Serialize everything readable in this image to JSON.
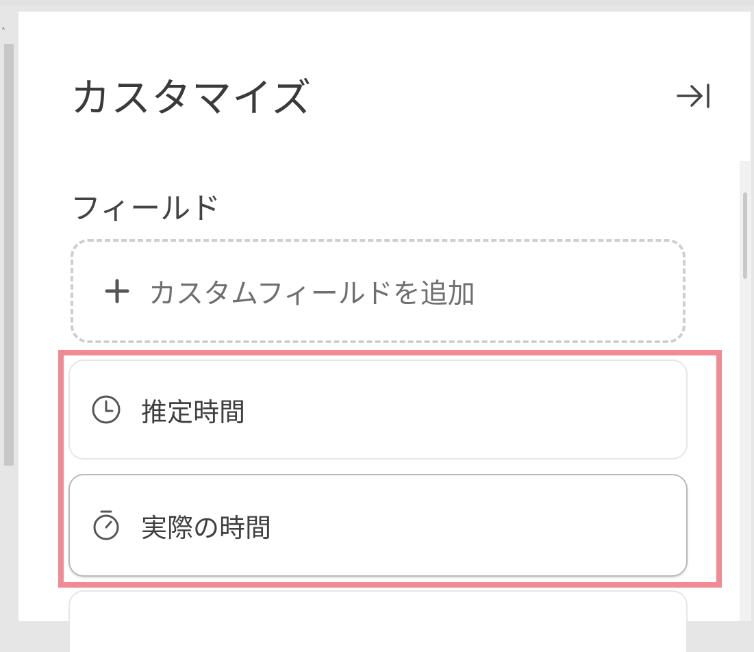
{
  "panel": {
    "title": "カスタマイズ",
    "collapse_icon": "collapse-right-icon"
  },
  "fields_section": {
    "label": "フィールド",
    "add_button": {
      "label": "カスタムフィールドを追加",
      "icon": "plus-icon"
    },
    "items": [
      {
        "label": "推定時間",
        "icon": "clock-icon"
      },
      {
        "label": "実際の時間",
        "icon": "stopwatch-icon"
      },
      {
        "label": ""
      }
    ]
  },
  "colors": {
    "highlight": "#f08a94",
    "panel_background": "#ffffff",
    "page_background": "#e6e6e6"
  }
}
